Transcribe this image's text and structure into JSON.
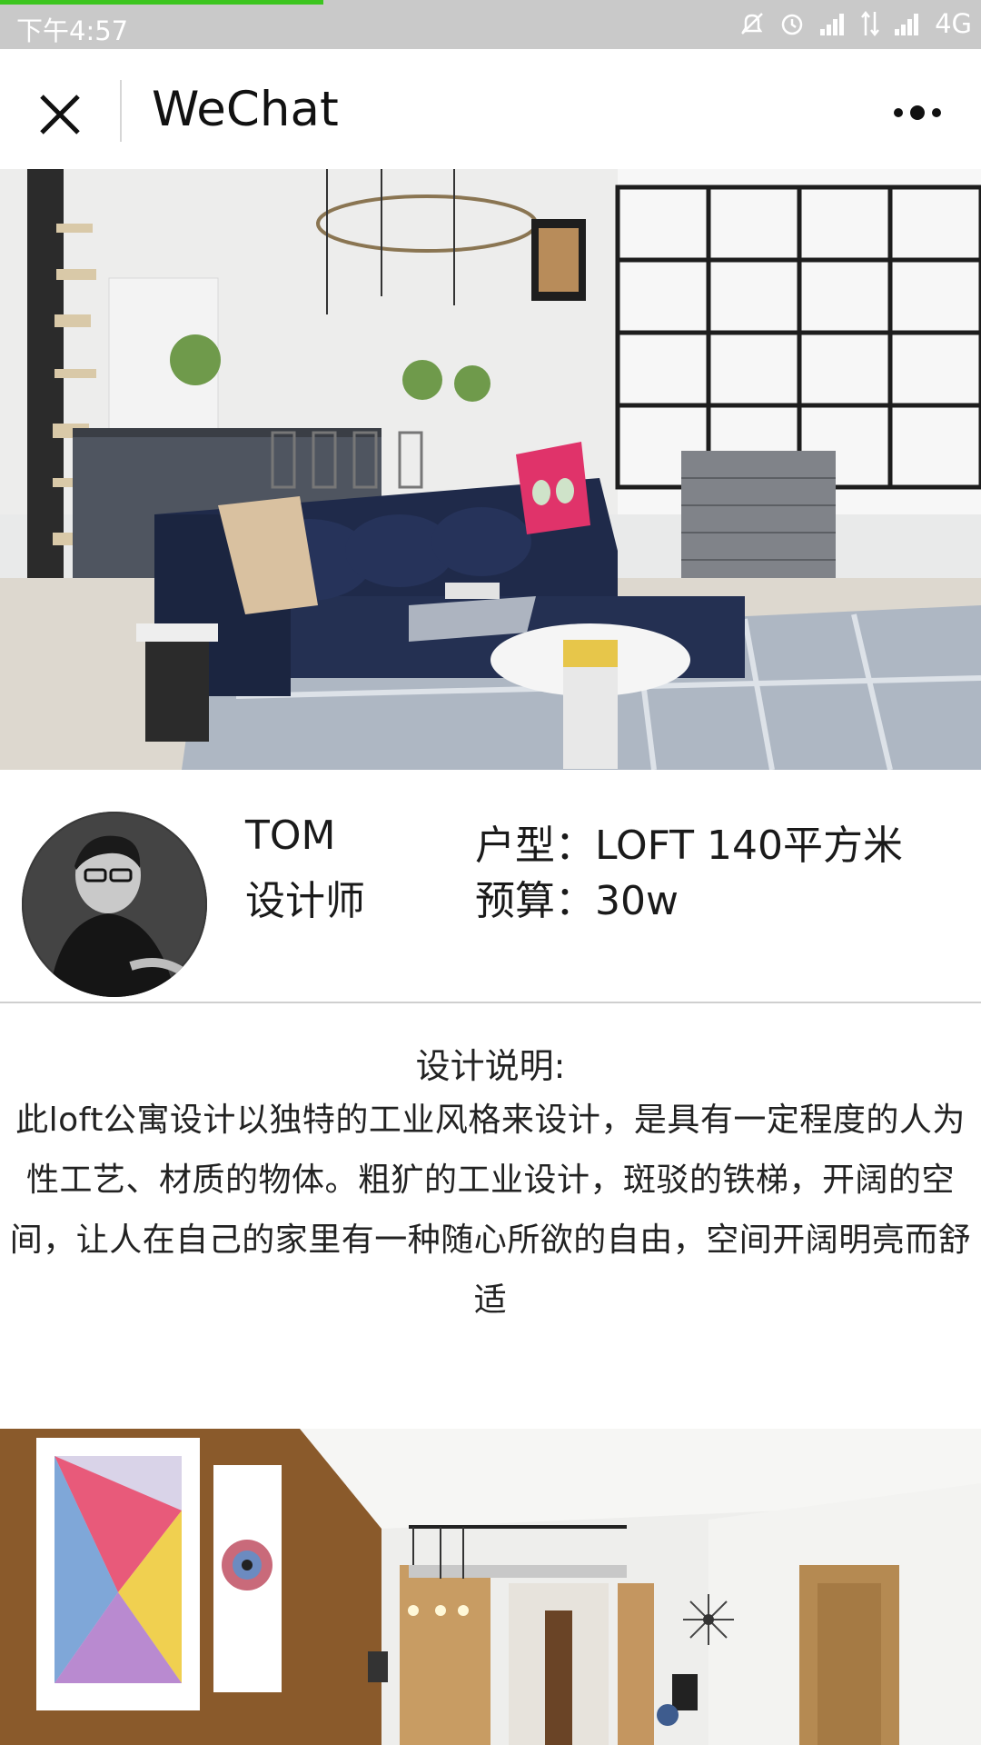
{
  "status_bar": {
    "time": "下午4:57",
    "network": "4G",
    "load_progress": 0.33,
    "icons": [
      "mute-icon",
      "alarm-icon",
      "signal-icon",
      "data-arrows-icon",
      "signal-icon"
    ]
  },
  "nav": {
    "title": "WeChat",
    "close_icon": "close-icon",
    "more_icon": "more-icon"
  },
  "designer": {
    "name": "TOM",
    "role": "设计师",
    "house_type": "户型：LOFT 140平方米",
    "budget": "预算：30w"
  },
  "description": {
    "heading": "设计说明:",
    "body": "此loft公寓设计以独特的工业风格来设计，是具有一定程度的人为性工艺、材质的物体。粗犷的工业设计，斑驳的铁梯，开阔的空间，让人在自己的家里有一种随心所欲的自由，空间开阔明亮而舒适"
  },
  "colors": {
    "status_bar": "#c9c9c9",
    "progress": "#3cc51f",
    "sofa": "#1f2a4a",
    "pillow": "#e0336a"
  }
}
